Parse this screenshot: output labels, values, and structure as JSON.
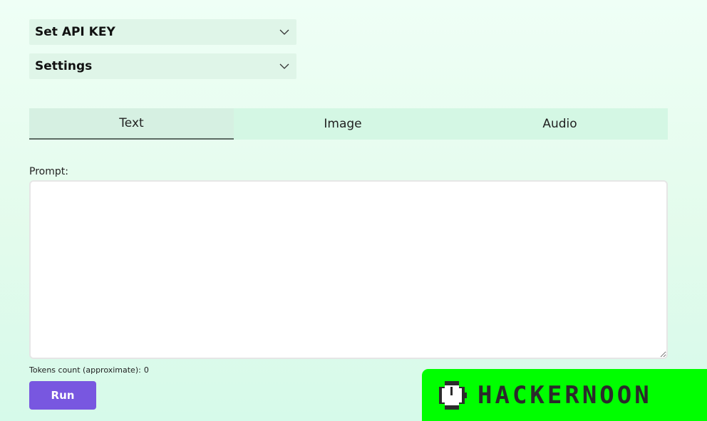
{
  "accordions": [
    {
      "label": "Set API KEY",
      "icon": "chevron-down-icon"
    },
    {
      "label": "Settings",
      "icon": "chevron-down-icon"
    }
  ],
  "tabs": [
    {
      "label": "Text",
      "active": true
    },
    {
      "label": "Image",
      "active": false
    },
    {
      "label": "Audio",
      "active": false
    }
  ],
  "prompt": {
    "label": "Prompt:",
    "value": "",
    "placeholder": ""
  },
  "tokens": {
    "label": "Tokens count (approximate):",
    "value": "0"
  },
  "run_button": {
    "label": "Run"
  },
  "watermark": {
    "text": "HACKERNOON",
    "icon": "hackernoon-logo-icon",
    "color": "#00ff00"
  },
  "colors": {
    "accent": "#7857e0",
    "tab_bar": "#d4f7e4",
    "accordion": "#dff5e8"
  }
}
